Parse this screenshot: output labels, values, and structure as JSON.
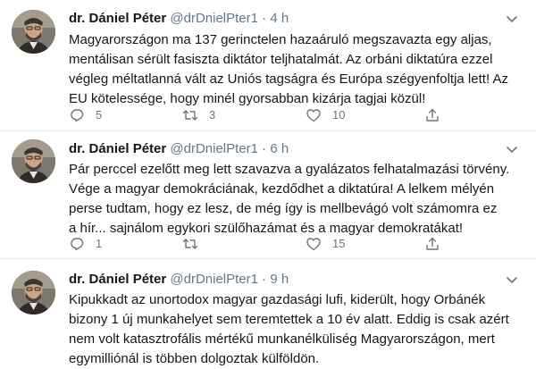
{
  "tweets": [
    {
      "name": "dr. Dániel Péter",
      "handle": "@drDnielPter1",
      "separator": "·",
      "time": "4 h",
      "text": "Magyarországon ma 137 gerinctelen hazaáruló megszavazta egy aljas,\nmentálisan sérült fasiszta diktátor teljhatalmát. Az orbáni diktatúra ezzel\nvégleg méltatlanná vált az Uniós tagságra és Európa szégyenfoltja lett! Az\nEU kötelessége, hogy minél gyorsabban kizárja tagjai közül!",
      "replies": "5",
      "retweets": "3",
      "likes": "10"
    },
    {
      "name": "dr. Dániel Péter",
      "handle": "@drDnielPter1",
      "separator": "·",
      "time": "6 h",
      "text": "Pár perccel ezelőtt meg lett szavazva a gyalázatos felhatalmazási törvény.\nVége a magyar demokráciának, kezdődhet a diktatúra! A lelkem mélyén\nperse tudtam, hogy ez lesz, de még így is mellbevágó volt számomra ez\na hír... sajnálom egykori szülőhazámat és a magyar demokratákat!",
      "replies": "1",
      "retweets": "",
      "likes": "15"
    },
    {
      "name": "dr. Dániel Péter",
      "handle": "@drDnielPter1",
      "separator": "·",
      "time": "9 h",
      "text": "Kipukkadt az unortodox magyar gazdasági lufi, kiderült, hogy Orbánék\nbizony 1 új munkahelyet sem teremtettek a 10 év alatt. Eddig is csak azért\nnem volt katasztrofális mértékű munkanélküliség Magyarországon, mert\negymilliónál is többen dolgoztak külföldön.",
      "replies": "",
      "retweets": "",
      "likes": ""
    }
  ],
  "icons": {
    "reply": "reply-icon",
    "retweet": "retweet-icon",
    "like": "heart-icon",
    "share": "share-icon",
    "caret": "chevron-down-icon"
  },
  "colors": {
    "text": "#14171a",
    "secondary": "#657786",
    "divider": "#e6ecf0"
  }
}
